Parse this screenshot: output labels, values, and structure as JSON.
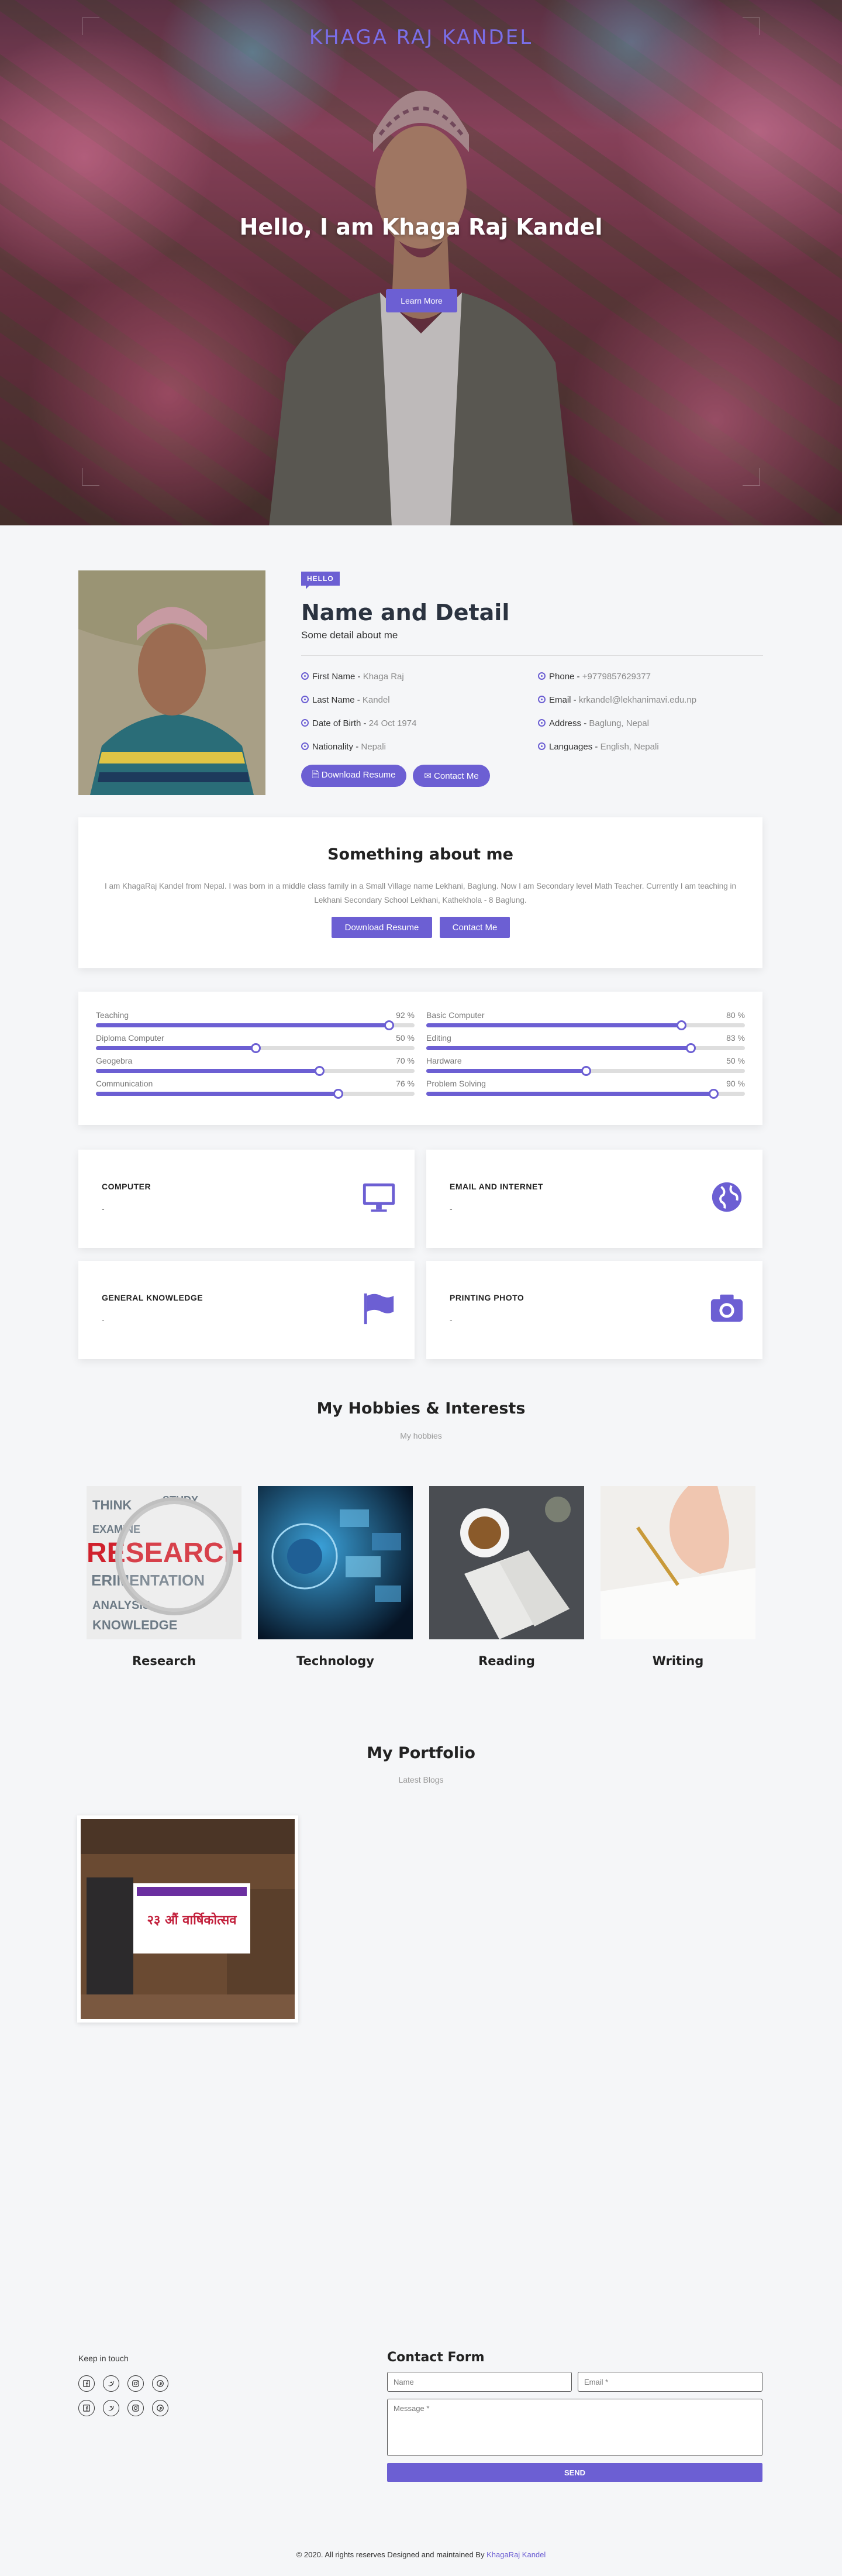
{
  "hero": {
    "brand_name": "KHAGA RAJ KANDEL",
    "headline": "Hello, I am Khaga Raj Kandel",
    "cta_label": "Learn More"
  },
  "profile": {
    "badge": "HELLO",
    "title": "Name and Detail",
    "subtitle": "Some detail about me",
    "fields_left": [
      {
        "label": "First Name",
        "value": "Khaga Raj"
      },
      {
        "label": "Last Name",
        "value": "Kandel"
      },
      {
        "label": "Date of Birth",
        "value": "24 Oct 1974"
      },
      {
        "label": "Nationality",
        "value": "Nepali"
      }
    ],
    "fields_right": [
      {
        "label": "Phone",
        "value": "+9779857629377"
      },
      {
        "label": "Email",
        "value": "krkandel@lekhanimavi.edu.np"
      },
      {
        "label": "Address",
        "value": "Baglung, Nepal"
      },
      {
        "label": "Languages",
        "value": "English, Nepali"
      }
    ],
    "download_label": "Download Resume",
    "contact_label": "Contact Me"
  },
  "about": {
    "title": "Something about me",
    "text": "I am KhagaRaj Kandel from Nepal. I was born in a middle class family in a Small Village name Lekhani, Baglung. Now I am Secondary level Math Teacher. Currently I am teaching in Lekhani Secondary School Lekhani, Kathekhola - 8 Baglung.",
    "download_label": "Download Resume",
    "contact_label": "Contact Me"
  },
  "skills": [
    {
      "name": "Teaching",
      "percent": 92,
      "label": "92 %"
    },
    {
      "name": "Basic Computer",
      "percent": 80,
      "label": "80 %"
    },
    {
      "name": "Diploma Computer",
      "percent": 50,
      "label": "50 %"
    },
    {
      "name": "Editing",
      "percent": 83,
      "label": "83 %"
    },
    {
      "name": "Geogebra",
      "percent": 70,
      "label": "70 %"
    },
    {
      "name": "Hardware",
      "percent": 50,
      "label": "50 %"
    },
    {
      "name": "Communication",
      "percent": 76,
      "label": "76 %"
    },
    {
      "name": "Problem Solving",
      "percent": 90,
      "label": "90 %"
    }
  ],
  "services": [
    {
      "title": "COMPUTER",
      "detail": "-",
      "icon": "monitor-icon"
    },
    {
      "title": "EMAIL AND INTERNET",
      "detail": "-",
      "icon": "globe-icon"
    },
    {
      "title": "GENERAL KNOWLEDGE",
      "detail": "-",
      "icon": "flag-icon"
    },
    {
      "title": "PRINTING PHOTO",
      "detail": "-",
      "icon": "camera-icon"
    }
  ],
  "hobbies": {
    "title": "My Hobbies & Interests",
    "subtitle": "My hobbies",
    "items": [
      {
        "caption": "Research",
        "image_text": "RESEARCH"
      },
      {
        "caption": "Technology"
      },
      {
        "caption": "Reading"
      },
      {
        "caption": "Writing"
      }
    ]
  },
  "portfolio": {
    "title": "My Portfolio",
    "subtitle": "Latest Blogs",
    "items": [
      {
        "banner_text": "२३ औं वार्षिकोत्सव"
      }
    ]
  },
  "footer": {
    "keep_in_touch": "Keep in touch",
    "social_icons": [
      "facebook-icon",
      "twitter-icon",
      "instagram-icon",
      "pinterest-icon"
    ],
    "contact_title": "Contact Form",
    "name_placeholder": "Name",
    "email_placeholder": "Email *",
    "message_placeholder": "Message *",
    "send_label": "SEND",
    "copyright_text": "© 2020. All rights reserves Designed and maintained By",
    "copyright_link": "KhagaRaj Kandel"
  },
  "colors": {
    "accent": "#6c5fd3",
    "page_bg": "#f5f6f8"
  }
}
